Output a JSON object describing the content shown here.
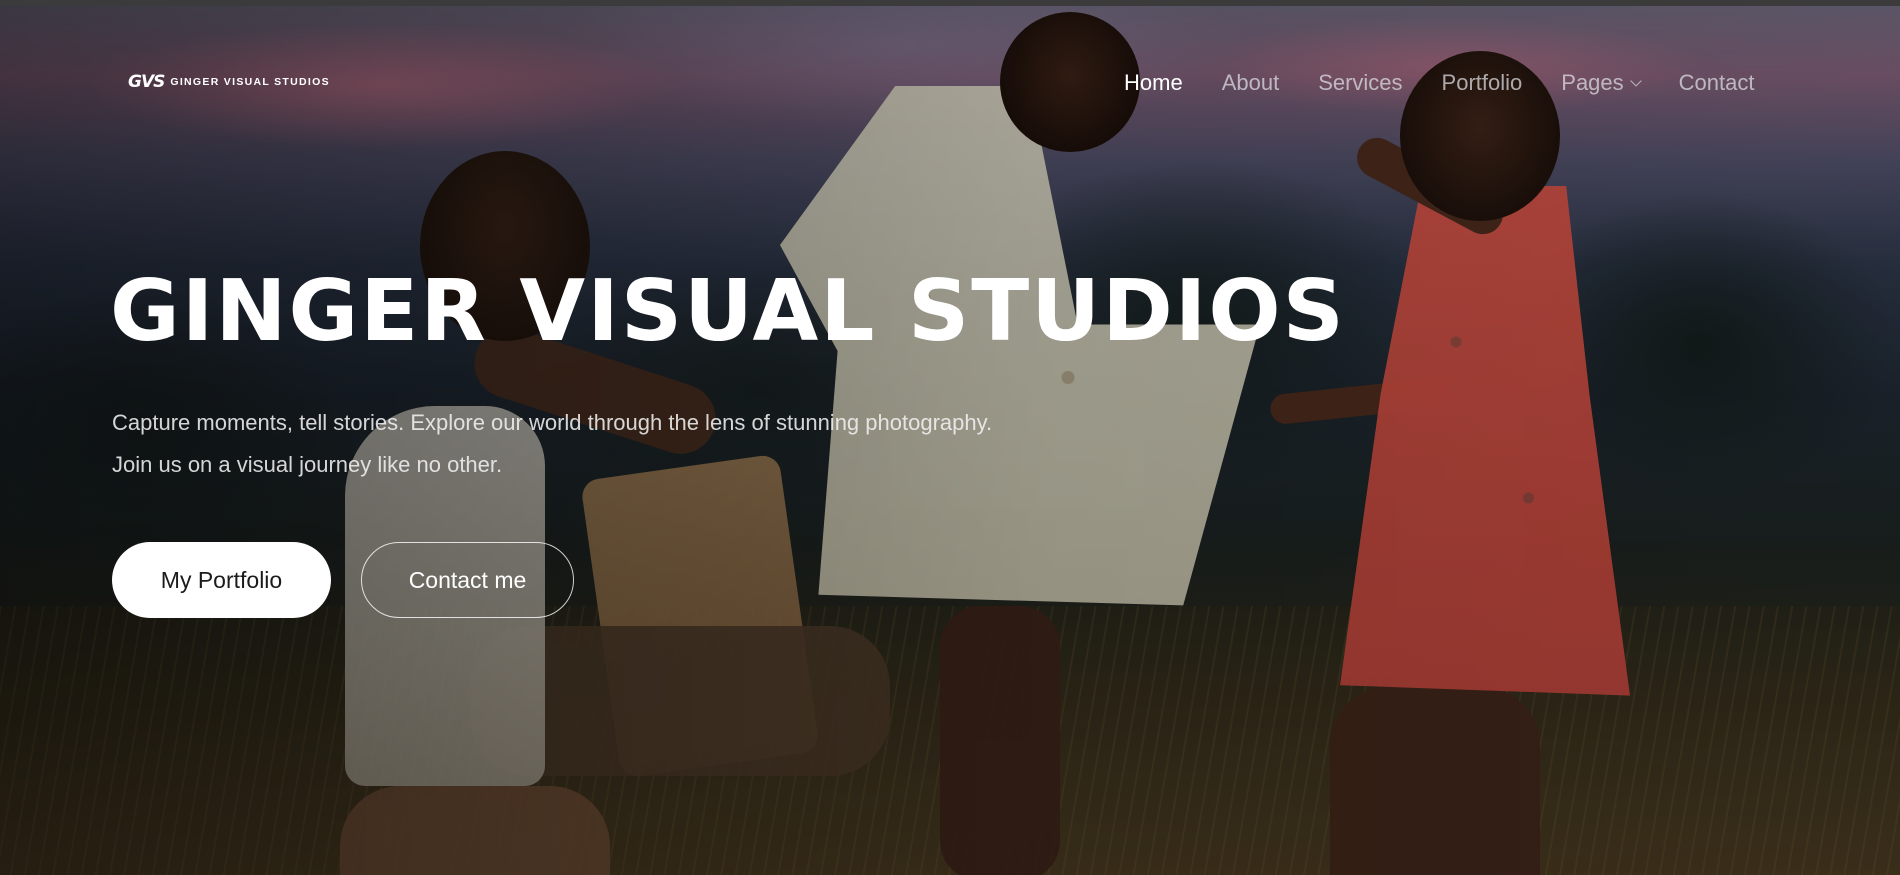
{
  "brand": {
    "logo_mark": "GVS",
    "logo_text": "GINGER VISUAL STUDIOS"
  },
  "nav": {
    "items": [
      {
        "label": "Home",
        "active": true
      },
      {
        "label": "About"
      },
      {
        "label": "Services"
      },
      {
        "label": "Portfolio"
      },
      {
        "label": "Pages",
        "has_dropdown": true
      },
      {
        "label": "Contact"
      }
    ]
  },
  "hero": {
    "title": "GINGER VISUAL STUDIOS",
    "subtitle_line1": "Capture moments, tell stories. Explore our world through the lens of stunning photography.",
    "subtitle_line2": "Join us on a visual journey like no other.",
    "primary_button": "My Portfolio",
    "secondary_button": "Contact me",
    "background_icon": "hero-photo-dancers"
  },
  "colors": {
    "text_primary": "#ffffff",
    "nav_inactive": "#dcdce1",
    "button_primary_bg": "#ffffff",
    "button_primary_text": "#1b1b1b"
  }
}
